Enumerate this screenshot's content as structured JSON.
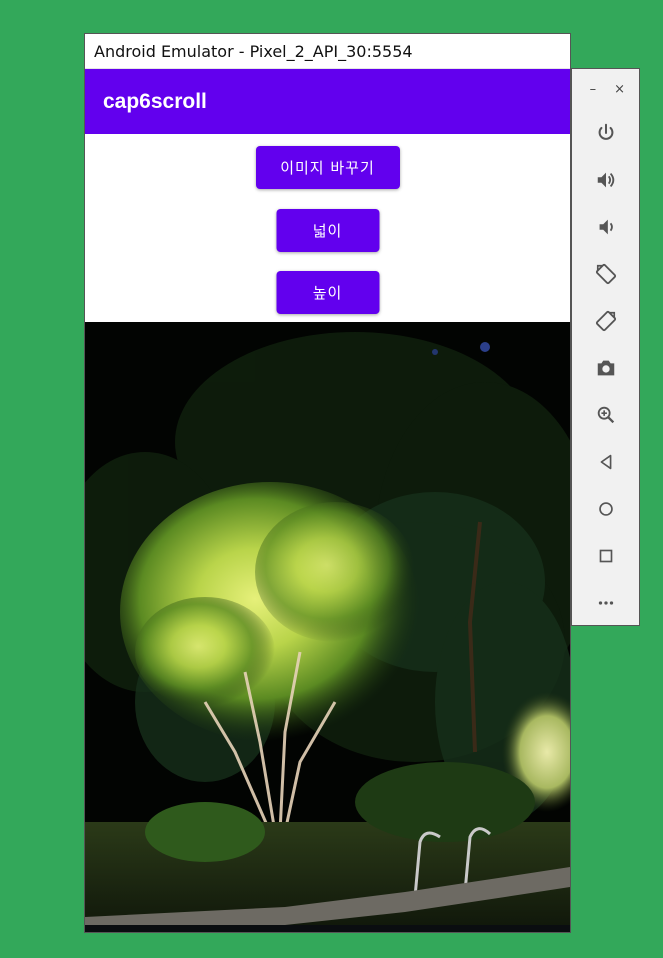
{
  "window": {
    "title": "Android Emulator - Pixel_2_API_30:5554"
  },
  "app": {
    "title": "cap6scroll",
    "buttons": {
      "change_image": "이미지 바꾸기",
      "width": "넓이",
      "height": "높이"
    },
    "image_description": "night garden scene with illuminated tree"
  },
  "toolbar": {
    "minimize_label": "–",
    "close_label": "×",
    "items": [
      {
        "name": "power-icon"
      },
      {
        "name": "volume-up-icon"
      },
      {
        "name": "volume-down-icon"
      },
      {
        "name": "rotate-left-icon"
      },
      {
        "name": "rotate-right-icon"
      },
      {
        "name": "camera-icon"
      },
      {
        "name": "zoom-icon"
      },
      {
        "name": "back-icon"
      },
      {
        "name": "home-icon"
      },
      {
        "name": "overview-icon"
      },
      {
        "name": "more-icon"
      }
    ]
  },
  "colors": {
    "desktop": "#33a85a",
    "primary": "#6200ee"
  }
}
